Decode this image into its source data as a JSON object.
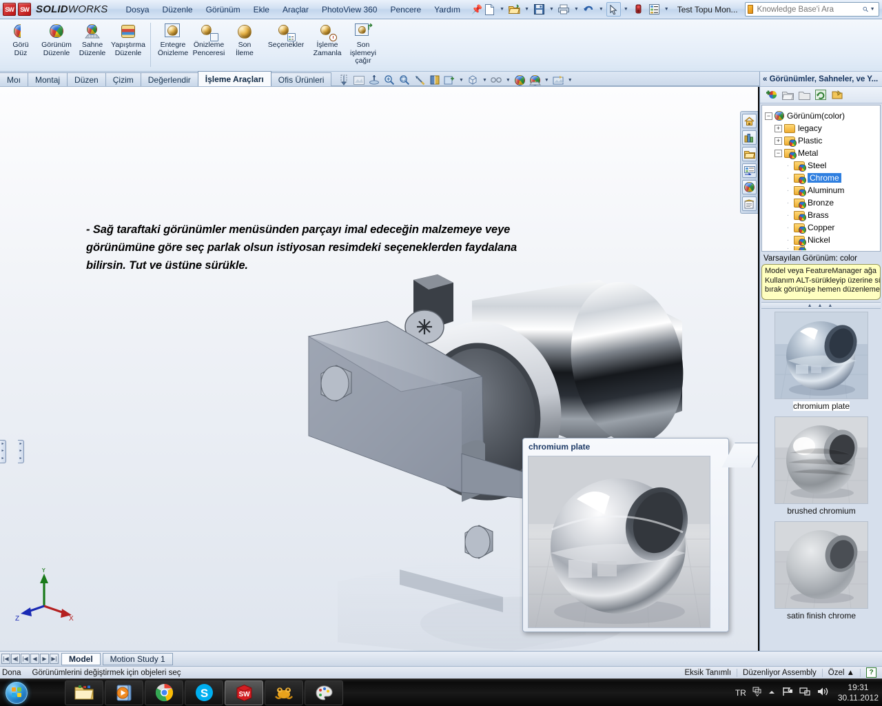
{
  "titlebar": {
    "app_name_bold": "SOLID",
    "app_name_light": "WORKS",
    "menus": [
      "Dosya",
      "Düzenle",
      "Görünüm",
      "Ekle",
      "Araçlar",
      "PhotoView 360",
      "Pencere",
      "Yardım"
    ],
    "pin_icon": "pushpin-icon",
    "document_name": "Test Topu Mon...",
    "search_placeholder": "Knowledge Base'i Ara",
    "quick_access": [
      {
        "name": "new-document-icon"
      },
      {
        "name": "open-document-icon"
      },
      {
        "name": "save-icon"
      },
      {
        "name": "print-icon"
      },
      {
        "name": "undo-icon"
      },
      {
        "name": "select-cursor-icon"
      },
      {
        "name": "rebuild-icon"
      },
      {
        "name": "options-icon"
      }
    ],
    "window_buttons": [
      "minimize",
      "restore",
      "close"
    ]
  },
  "ribbon": {
    "groups": [
      {
        "buttons": [
          {
            "label": "Görü\nDüz",
            "icon": "appearance-edit-icon"
          },
          {
            "label": "Görünüm\nDüzenle",
            "icon": "view-edit-icon"
          },
          {
            "label": "Sahne\nDüzenle",
            "icon": "scene-edit-icon"
          },
          {
            "label": "Yapıştırma\nDüzenle",
            "icon": "decal-edit-icon"
          }
        ]
      },
      {
        "buttons": [
          {
            "label": "Entegre\nÖnizleme",
            "icon": "integrated-preview-icon"
          },
          {
            "label": "Önizleme\nPenceresi",
            "icon": "preview-window-icon"
          },
          {
            "label": "Son\nİleme",
            "icon": "final-render-icon"
          },
          {
            "label": "Seçenekler",
            "icon": "render-options-icon"
          },
          {
            "label": "İşleme\nZamanla",
            "icon": "schedule-render-icon"
          },
          {
            "label": "Son\nişlemeyi\nçağır",
            "icon": "recall-render-icon"
          }
        ]
      }
    ]
  },
  "command_tabs": {
    "items": [
      "Moı",
      "Montaj",
      "Düzen",
      "Çizim",
      "Değerlendir",
      "İşleme Araçları",
      "Ofis Ürünleri"
    ],
    "active": "İşleme Araçları"
  },
  "view_toolbar": {
    "buttons": [
      {
        "name": "section-view-icon"
      },
      {
        "name": "display-style-icon"
      },
      {
        "name": "view-orientation-icon"
      },
      {
        "name": "zoom-to-area-icon"
      },
      {
        "name": "zoom-to-fit-icon"
      },
      {
        "name": "previous-view-icon"
      },
      {
        "name": "section-cut-icon"
      },
      {
        "name": "view-settings-icon"
      },
      {
        "name": "display-style-cube-icon"
      },
      {
        "name": "hide-show-icon"
      },
      {
        "name": "appearances-ball-icon"
      },
      {
        "name": "scene-icon"
      },
      {
        "name": "apply-scene-icon"
      }
    ]
  },
  "viewport": {
    "annotation": "- Sağ taraftaki görünümler menüsünden parçayı imal edeceğin malzemeye veye görünümüne göre seç parlak olsun istiyosan resimdeki seçeneklerden faydalana bilirsin. Tut ve üstüne sürükle.",
    "triad": {
      "x": "X",
      "y": "Y",
      "z": "Z"
    },
    "callout": {
      "title": "chromium plate"
    },
    "task_pane_buttons": [
      {
        "name": "design-library-home-icon"
      },
      {
        "name": "design-library-icon"
      },
      {
        "name": "file-explorer-icon"
      },
      {
        "name": "view-palette-icon"
      },
      {
        "name": "appearances-scenes-icon"
      },
      {
        "name": "custom-properties-icon"
      }
    ]
  },
  "right_panel": {
    "header": "« Görünümler, Sahneler, ve Y...",
    "toolbar": [
      {
        "name": "new-appearance-icon"
      },
      {
        "name": "open-folder-icon"
      },
      {
        "name": "close-folder-icon"
      },
      {
        "name": "refresh-icon"
      },
      {
        "name": "next-folder-icon"
      }
    ],
    "tree": [
      {
        "label": "Görünüm(color)",
        "indent": 0,
        "expander": "-",
        "icon": "appearance-ball-icon"
      },
      {
        "label": "legacy",
        "indent": 1,
        "expander": "+",
        "icon": "folder-icon"
      },
      {
        "label": "Plastic",
        "indent": 1,
        "expander": "+",
        "icon": "folder-appearance-icon"
      },
      {
        "label": "Metal",
        "indent": 1,
        "expander": "-",
        "icon": "folder-appearance-icon"
      },
      {
        "label": "Steel",
        "indent": 2,
        "expander": "",
        "icon": "folder-appearance-icon"
      },
      {
        "label": "Chrome",
        "indent": 2,
        "expander": "",
        "icon": "folder-appearance-icon",
        "selected": true
      },
      {
        "label": "Aluminum",
        "indent": 2,
        "expander": "",
        "icon": "folder-appearance-icon"
      },
      {
        "label": "Bronze",
        "indent": 2,
        "expander": "",
        "icon": "folder-appearance-icon"
      },
      {
        "label": "Brass",
        "indent": 2,
        "expander": "",
        "icon": "folder-appearance-icon"
      },
      {
        "label": "Copper",
        "indent": 2,
        "expander": "",
        "icon": "folder-appearance-icon"
      },
      {
        "label": "Nickel",
        "indent": 2,
        "expander": "",
        "icon": "folder-appearance-icon"
      }
    ],
    "default_appearance": "Varsayılan Görünüm: color",
    "tip_lines": [
      "   Model veya FeatureManager ağa",
      "Kullanım ALT-sürükleyip üzerine sür",
      "bırak görünüşe hemen düzenlemek"
    ],
    "swatches": [
      {
        "caption": "chromium plate",
        "selected": true
      },
      {
        "caption": "brushed chromium",
        "selected": false
      },
      {
        "caption": "satin finish chrome",
        "selected": false
      }
    ]
  },
  "bottom_tabs": {
    "nav_buttons": [
      "|◀",
      "◀|",
      "|◀",
      "◀",
      "▶",
      "▶|"
    ],
    "tabs": [
      "Model",
      "Motion Study 1"
    ],
    "active": "Model"
  },
  "statusbar": {
    "left_label": "Dona",
    "message": "Görünümlerini değiştirmek için objeleri seç",
    "segments": [
      "Eksik Tanımlı",
      "Düzenliyor Assembly",
      "Özel  ▲"
    ],
    "help_icon": "help-question-icon"
  },
  "taskbar": {
    "start_button": "start-orb-icon",
    "items": [
      {
        "name": "windows-explorer-icon"
      },
      {
        "name": "media-player-icon"
      },
      {
        "name": "google-chrome-icon"
      },
      {
        "name": "skype-icon"
      },
      {
        "name": "solidworks-icon"
      },
      {
        "name": "winrar-frog-icon"
      },
      {
        "name": "paint-icon"
      }
    ],
    "tray": {
      "language": "TR",
      "icons": [
        "keyboard-layout-icon",
        "show-hidden-icons-icon",
        "action-center-flag-icon",
        "network-icon",
        "volume-icon"
      ],
      "time": "19:31",
      "date": "30.11.2012"
    }
  },
  "colors": {
    "accent": "#2f7fe0",
    "ribbon_bg": "#e4edf8",
    "panel_bg": "#d6dfec",
    "tip_bg": "#ffffc0"
  }
}
